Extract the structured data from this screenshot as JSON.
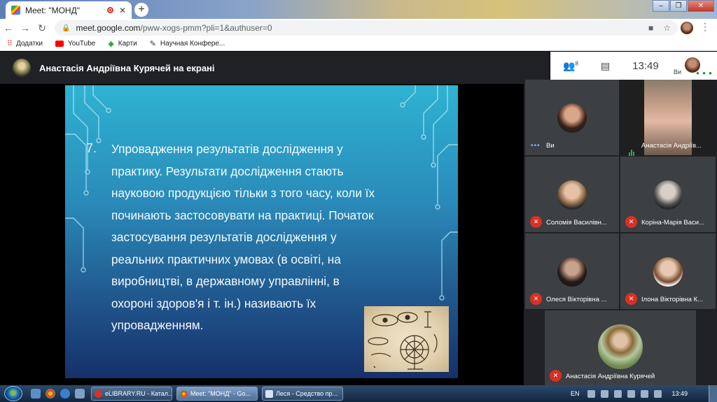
{
  "browser": {
    "tab_title": "Meet: \"МОНД\"",
    "new_tab_label": "+",
    "url_host": "meet.google.com",
    "url_path": "/pww-xogs-pmm?pli=1&authuser=0",
    "bookmarks": [
      {
        "label": "Додатки",
        "icon": "apps-icon"
      },
      {
        "label": "YouTube",
        "icon": "youtube-icon"
      },
      {
        "label": "Карти",
        "icon": "maps-icon"
      },
      {
        "label": "Научная Конфере...",
        "icon": "conference-icon"
      }
    ]
  },
  "meet": {
    "presenter_title": "Анастасія Андріївна Курячей на екрані",
    "participant_count": "8",
    "clock": "13:49",
    "self_label": "Ви"
  },
  "slide": {
    "number": "7.",
    "lines": [
      "Упровадження  результатів  дослідження  у",
      "практику. Результати дослідження стають",
      "науковою продукцією тільки з того часу, коли їх",
      "починають застосовувати на практиці. Початок",
      "застосування результатів дослідження у",
      "реальних практичних умовах (в освіті, на",
      "виробництві, в державному управлінні, в",
      "охороні здоров'я і т. ін.) називають їх",
      "упровадженням."
    ]
  },
  "participants": [
    {
      "name": "Ви",
      "muted": false,
      "state": "self"
    },
    {
      "name": "Анастасія Андріїв...",
      "muted": false,
      "state": "speaking"
    },
    {
      "name": "Соломія Василівн...",
      "muted": true,
      "state": "muted"
    },
    {
      "name": "Коріна-Марія Васи...",
      "muted": true,
      "state": "muted"
    },
    {
      "name": "Олеся Вікторівна ...",
      "muted": true,
      "state": "muted"
    },
    {
      "name": "Ілона Вікторівна К...",
      "muted": true,
      "state": "muted"
    },
    {
      "name": "Анастасія Андріївна Курячей",
      "muted": true,
      "state": "muted"
    }
  ],
  "taskbar": {
    "tasks": [
      {
        "label": "eLIBRARY.RU - Катал...",
        "active": false
      },
      {
        "label": "Meet: \"МОНД\" - Go...",
        "active": true
      },
      {
        "label": "Леся - Средство пр...",
        "active": false
      }
    ],
    "language": "EN",
    "time": "13:49"
  }
}
